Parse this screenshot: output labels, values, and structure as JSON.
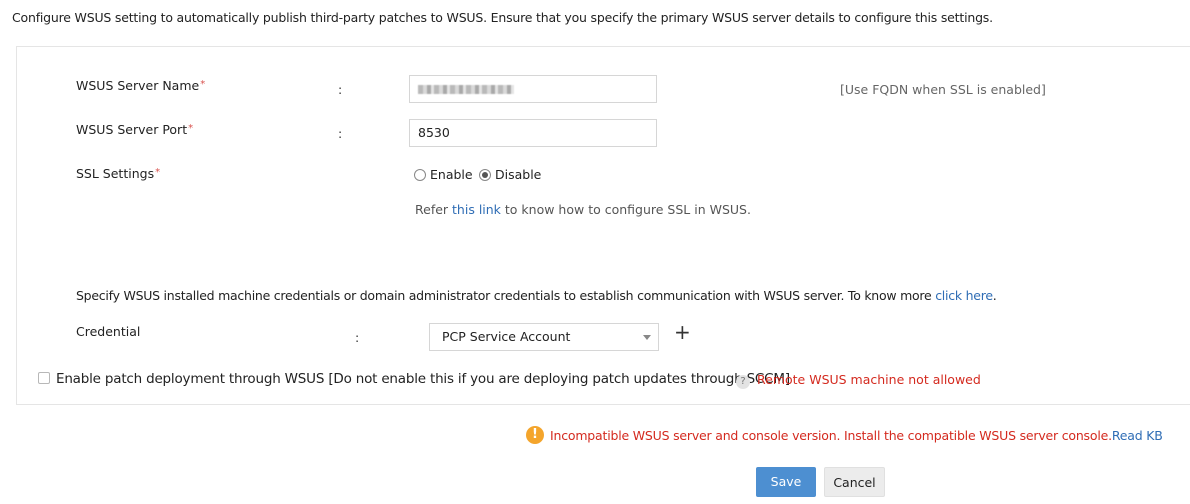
{
  "intro_text": "Configure WSUS setting to automatically publish third-party patches to WSUS. Ensure that you specify the primary WSUS server details to configure this settings.",
  "form": {
    "server_name": {
      "label": "WSUS Server Name",
      "required_mark": "*",
      "colon": ":",
      "hint": "[Use FQDN when SSL is enabled]"
    },
    "server_port": {
      "label": "WSUS Server Port",
      "required_mark": "*",
      "colon": ":",
      "value": "8530"
    },
    "ssl": {
      "label": "SSL Settings",
      "required_mark": "*",
      "options": [
        {
          "label": "Enable",
          "selected": false
        },
        {
          "label": "Disable",
          "selected": true
        }
      ],
      "refer_prefix": "Refer ",
      "refer_link": "this link",
      "refer_suffix": " to know how to configure SSL in WSUS."
    },
    "credential_info": {
      "text": "Specify WSUS installed machine credentials or domain administrator credentials to establish communication with WSUS server. To know more ",
      "link": "click here",
      "suffix": "."
    },
    "credential": {
      "label": "Credential",
      "colon": ":",
      "selected": "PCP Service Account",
      "add_symbol": "+"
    },
    "deployment": {
      "checked": false,
      "label": "Enable patch deployment through WSUS [Do not enable this if you are deploying patch updates through SCCM]",
      "help_symbol": "?",
      "error": "Remote WSUS machine not allowed"
    }
  },
  "warning": {
    "icon_symbol": "!",
    "text": "Incompatible WSUS server and console version. Install the compatible WSUS server console.",
    "link": "Read KB"
  },
  "buttons": {
    "save": "Save",
    "cancel": "Cancel"
  },
  "colors": {
    "primary_button": "#4d8fd1",
    "error_text": "#d42a1f",
    "link": "#2f6db5",
    "warning_icon": "#f4a52c"
  }
}
